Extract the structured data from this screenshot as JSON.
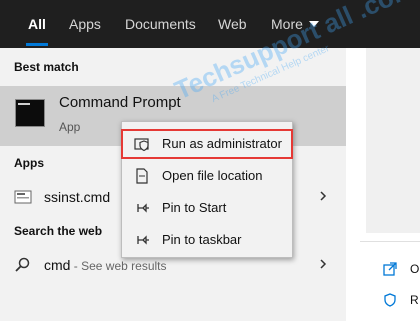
{
  "tabs": {
    "all": "All",
    "apps": "Apps",
    "documents": "Documents",
    "web": "Web",
    "more": "More"
  },
  "sections": {
    "best_match": "Best match",
    "apps": "Apps",
    "search_web": "Search the web"
  },
  "best_match": {
    "title": "Command Prompt",
    "subtitle": "App"
  },
  "apps_results": [
    {
      "label": "ssinst.cmd"
    }
  ],
  "web_results": [
    {
      "query": "cmd",
      "suffix": " - See web results"
    }
  ],
  "context_menu": {
    "items": [
      {
        "label": "Run as administrator",
        "highlighted": true
      },
      {
        "label": "Open file location"
      },
      {
        "label": "Pin to Start"
      },
      {
        "label": "Pin to taskbar"
      }
    ]
  },
  "right_pane": {
    "items": [
      {
        "label": "O"
      },
      {
        "label": "R"
      }
    ]
  },
  "watermark": {
    "main": "Techsupport all .com",
    "tagline": "A Free Technical Help center"
  },
  "colors": {
    "accent": "#0078d7",
    "highlight_outline": "#e53935",
    "selected_row": "#cfcfcf"
  }
}
